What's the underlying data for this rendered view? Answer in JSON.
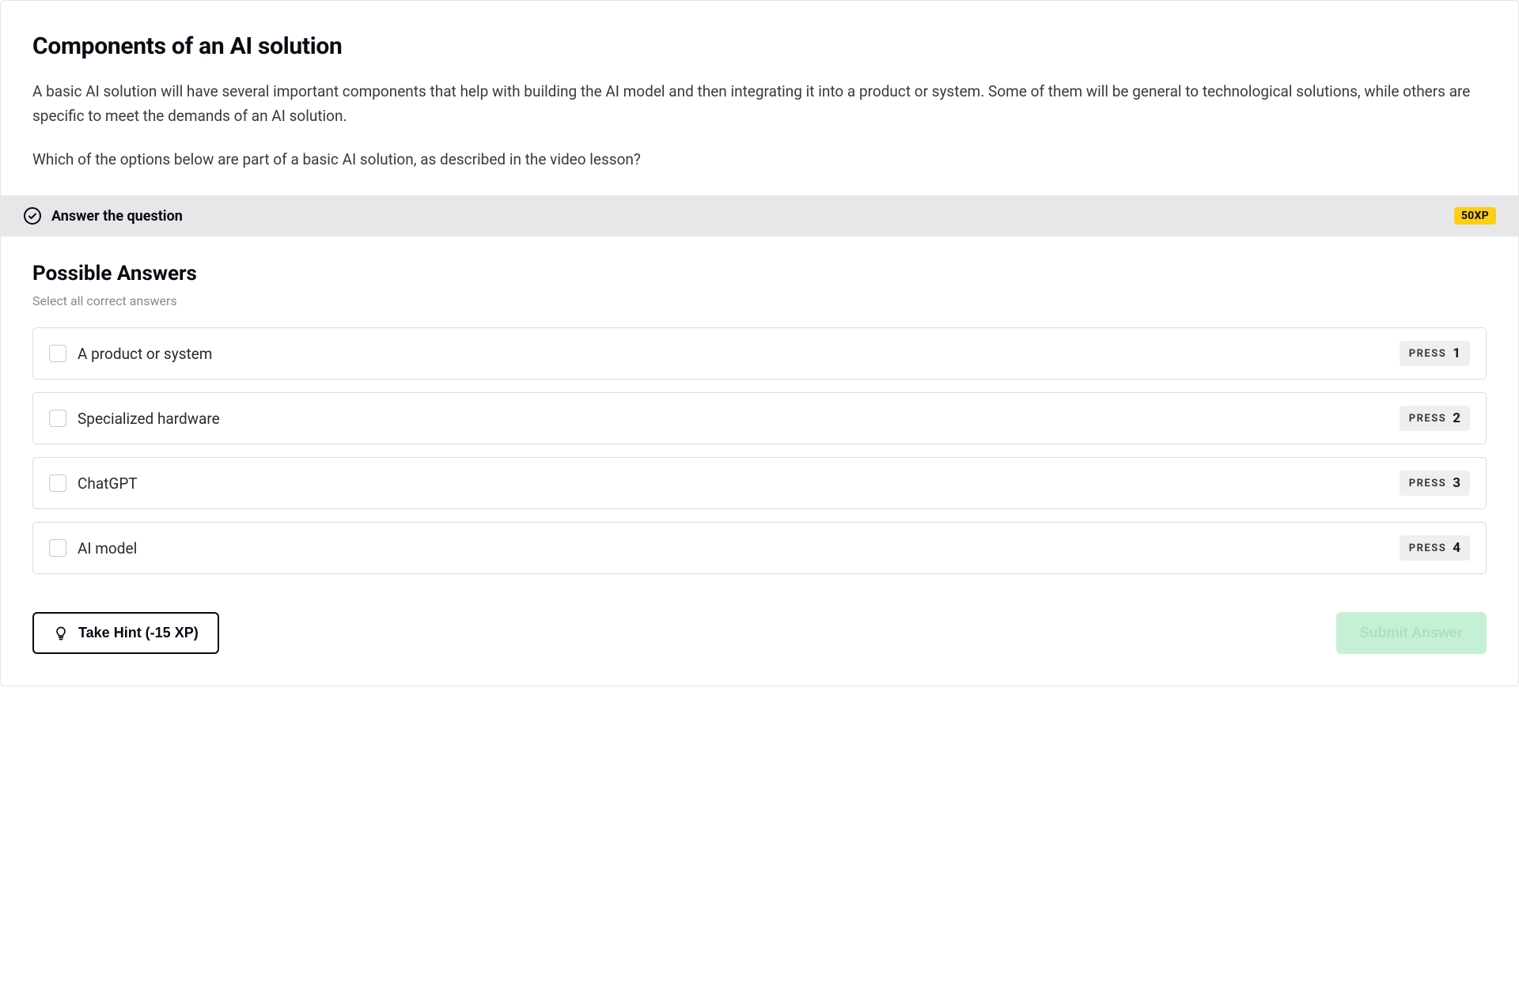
{
  "title": "Components of an AI solution",
  "description": "A basic AI solution will have several important components that help with building the AI model and then integrating it into a product or system. Some of them will be general to technological solutions, while others are specific to meet the demands of an AI solution.",
  "question": "Which of the options below are part of a basic AI solution, as described in the video lesson?",
  "instruction": {
    "text": "Answer the question",
    "xp": "50XP"
  },
  "answers": {
    "title": "Possible Answers",
    "subtitle": "Select all correct answers",
    "press_label": "PRESS",
    "items": [
      {
        "label": "A product or system",
        "key": "1"
      },
      {
        "label": "Specialized hardware",
        "key": "2"
      },
      {
        "label": "ChatGPT",
        "key": "3"
      },
      {
        "label": "AI model",
        "key": "4"
      }
    ]
  },
  "footer": {
    "hint_label": "Take Hint (-15 XP)",
    "submit_label": "Submit Answer"
  }
}
